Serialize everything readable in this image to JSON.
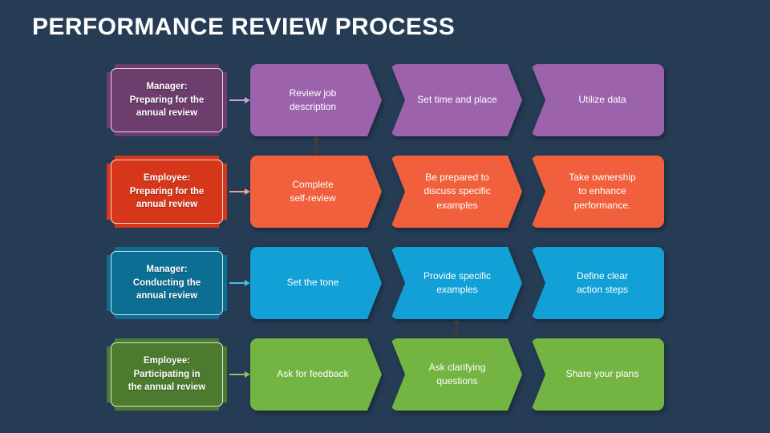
{
  "slide": {
    "title": "PERFORMANCE REVIEW PROCESS",
    "background_color": "#253c54"
  },
  "theme": {
    "title_color": "#ffffff",
    "card_text_color": "#ffffff"
  },
  "rows": [
    {
      "id": "manager-preparing",
      "label": "Manager:\nPreparing for the\nannual review",
      "label_line_1": "Manager:",
      "label_line_2": "Preparing for the",
      "label_line_3": "annual review",
      "label_fill": "#6d3d6e",
      "card_fill": "#9c63ac",
      "arrow_color": "#c9a3d6",
      "steps": [
        {
          "text": "Review job\ndescription"
        },
        {
          "text": "Set time and place"
        },
        {
          "text": "Utilize data"
        }
      ]
    },
    {
      "id": "employee-preparing",
      "label": "Employee:\nPreparing for the\nannual review",
      "label_line_1": "Employee:",
      "label_line_2": "Preparing for the",
      "label_line_3": "annual review",
      "label_fill": "#d6361a",
      "card_fill": "#f0603c",
      "arrow_color": "#f0a08c",
      "steps": [
        {
          "text": "Complete\nself-review"
        },
        {
          "text": "Be prepared to\ndiscuss specific\nexamples"
        },
        {
          "text": "Take ownership\nto enhance\nperformance."
        }
      ]
    },
    {
      "id": "manager-conducting",
      "label": "Manager:\nConducting the\nannual review",
      "label_line_1": "Manager:",
      "label_line_2": "Conducting the",
      "label_line_3": "annual review",
      "label_fill": "#0b6e92",
      "card_fill": "#12a0d6",
      "arrow_color": "#3fc0e8",
      "steps": [
        {
          "text": "Set the tone"
        },
        {
          "text": "Provide specific\nexamples"
        },
        {
          "text": "Define clear\naction steps"
        }
      ]
    },
    {
      "id": "employee-participating",
      "label": "Employee:\nParticipating in\nthe annual review",
      "label_line_1": "Employee:",
      "label_line_2": "Participating in",
      "label_line_3": "the annual review",
      "label_fill": "#4c7a2e",
      "card_fill": "#74b443",
      "arrow_color": "#8fc45f",
      "steps": [
        {
          "text": "Ask for feedback"
        },
        {
          "text": "Ask clarifying\nquestions"
        },
        {
          "text": "Share your plans"
        }
      ]
    }
  ],
  "vertical_connectors": [
    {
      "id": "connector-row1-row2",
      "from_row": "manager-preparing",
      "to_row": "employee-preparing",
      "color": "#4a3a32"
    },
    {
      "id": "connector-row3-row4",
      "from_row": "manager-conducting",
      "to_row": "employee-participating",
      "color": "#4a3a32"
    }
  ]
}
